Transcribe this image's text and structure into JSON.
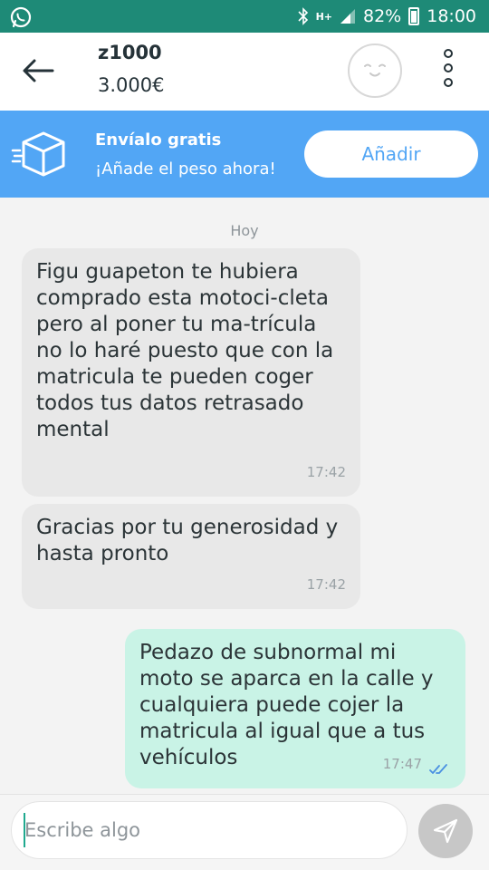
{
  "status_bar": {
    "battery": "82%",
    "time": "18:00",
    "network": "H+"
  },
  "header": {
    "title": "z1000",
    "price": "3.000€"
  },
  "banner": {
    "title": "Envíalo gratis",
    "subtitle": "¡Añade el peso ahora!",
    "button_label": "Añadir"
  },
  "chat": {
    "day_label": "Hoy",
    "messages": [
      {
        "direction": "incoming",
        "text": "Figu guapeton te hubiera comprado esta motoci-cleta pero al poner tu ma-trícula no lo haré puesto que con la matricula te pueden coger todos tus datos retrasado mental",
        "time": "17:42"
      },
      {
        "direction": "incoming",
        "text": "Gracias por tu generosidad y hasta pronto",
        "time": "17:42"
      },
      {
        "direction": "outgoing",
        "text": "Pedazo de subnormal mi moto se aparca en la calle y cualquiera puede cojer la matricula al igual que a tus vehículos",
        "time": "17:47",
        "read": true
      }
    ]
  },
  "composer": {
    "placeholder": "Escribe algo"
  },
  "colors": {
    "status_bar": "#1e8a77",
    "banner": "#52a6f5",
    "incoming_bubble": "#e8e8e8",
    "outgoing_bubble": "#c9f3e6",
    "read_check": "#4a90e2"
  },
  "icons": {
    "status_left": "whatsapp-icon",
    "status_bluetooth": "bluetooth-icon",
    "status_signal": "signal-icon",
    "status_battery": "battery-icon",
    "back": "back-arrow-icon",
    "avatar": "smiley-face-icon",
    "menu": "more-vertical-icon",
    "banner": "package-box-icon",
    "read": "double-check-icon",
    "send": "send-icon"
  }
}
